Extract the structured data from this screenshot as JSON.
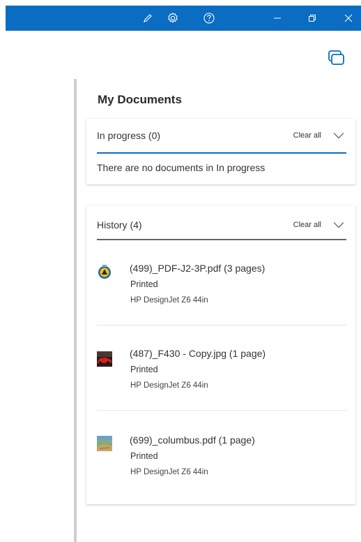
{
  "colors": {
    "titlebar": "#0a6dc2",
    "accent_underline": "#0a6dc2",
    "history_underline": "#666666"
  },
  "titlebar": {
    "icons": [
      "pencil-icon",
      "gear-icon",
      "help-icon",
      "minimize-icon",
      "restore-icon",
      "close-icon"
    ]
  },
  "panel": {
    "heading": "My Documents",
    "in_progress": {
      "label": "In progress (0)",
      "clear_label": "Clear all",
      "empty_message": "There are no documents in In progress"
    },
    "history": {
      "label": "History (4)",
      "clear_label": "Clear all",
      "items": [
        {
          "name": "(499)_PDF-J2-3P.pdf (3 pages)",
          "status": "Printed",
          "printer": "HP DesignJet Z6 44in",
          "thumb": "pdf-warning-icon"
        },
        {
          "name": "(487)_F430 - Copy.jpg (1 page)",
          "status": "Printed",
          "printer": "HP DesignJet Z6 44in",
          "thumb": "red-car-image"
        },
        {
          "name": "(699)_columbus.pdf (1 page)",
          "status": "Printed",
          "printer": "HP DesignJet Z6 44in",
          "thumb": "map-image"
        }
      ]
    }
  }
}
